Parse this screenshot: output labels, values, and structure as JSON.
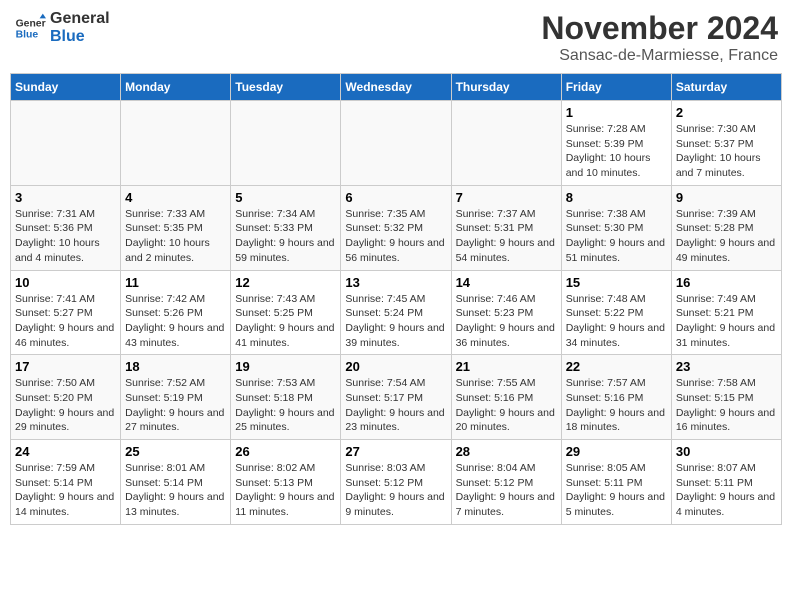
{
  "header": {
    "logo_line1": "General",
    "logo_line2": "Blue",
    "month_title": "November 2024",
    "location": "Sansac-de-Marmiesse, France"
  },
  "columns": [
    "Sunday",
    "Monday",
    "Tuesday",
    "Wednesday",
    "Thursday",
    "Friday",
    "Saturday"
  ],
  "weeks": [
    [
      {
        "day": "",
        "info": ""
      },
      {
        "day": "",
        "info": ""
      },
      {
        "day": "",
        "info": ""
      },
      {
        "day": "",
        "info": ""
      },
      {
        "day": "",
        "info": ""
      },
      {
        "day": "1",
        "info": "Sunrise: 7:28 AM\nSunset: 5:39 PM\nDaylight: 10 hours and 10 minutes."
      },
      {
        "day": "2",
        "info": "Sunrise: 7:30 AM\nSunset: 5:37 PM\nDaylight: 10 hours and 7 minutes."
      }
    ],
    [
      {
        "day": "3",
        "info": "Sunrise: 7:31 AM\nSunset: 5:36 PM\nDaylight: 10 hours and 4 minutes."
      },
      {
        "day": "4",
        "info": "Sunrise: 7:33 AM\nSunset: 5:35 PM\nDaylight: 10 hours and 2 minutes."
      },
      {
        "day": "5",
        "info": "Sunrise: 7:34 AM\nSunset: 5:33 PM\nDaylight: 9 hours and 59 minutes."
      },
      {
        "day": "6",
        "info": "Sunrise: 7:35 AM\nSunset: 5:32 PM\nDaylight: 9 hours and 56 minutes."
      },
      {
        "day": "7",
        "info": "Sunrise: 7:37 AM\nSunset: 5:31 PM\nDaylight: 9 hours and 54 minutes."
      },
      {
        "day": "8",
        "info": "Sunrise: 7:38 AM\nSunset: 5:30 PM\nDaylight: 9 hours and 51 minutes."
      },
      {
        "day": "9",
        "info": "Sunrise: 7:39 AM\nSunset: 5:28 PM\nDaylight: 9 hours and 49 minutes."
      }
    ],
    [
      {
        "day": "10",
        "info": "Sunrise: 7:41 AM\nSunset: 5:27 PM\nDaylight: 9 hours and 46 minutes."
      },
      {
        "day": "11",
        "info": "Sunrise: 7:42 AM\nSunset: 5:26 PM\nDaylight: 9 hours and 43 minutes."
      },
      {
        "day": "12",
        "info": "Sunrise: 7:43 AM\nSunset: 5:25 PM\nDaylight: 9 hours and 41 minutes."
      },
      {
        "day": "13",
        "info": "Sunrise: 7:45 AM\nSunset: 5:24 PM\nDaylight: 9 hours and 39 minutes."
      },
      {
        "day": "14",
        "info": "Sunrise: 7:46 AM\nSunset: 5:23 PM\nDaylight: 9 hours and 36 minutes."
      },
      {
        "day": "15",
        "info": "Sunrise: 7:48 AM\nSunset: 5:22 PM\nDaylight: 9 hours and 34 minutes."
      },
      {
        "day": "16",
        "info": "Sunrise: 7:49 AM\nSunset: 5:21 PM\nDaylight: 9 hours and 31 minutes."
      }
    ],
    [
      {
        "day": "17",
        "info": "Sunrise: 7:50 AM\nSunset: 5:20 PM\nDaylight: 9 hours and 29 minutes."
      },
      {
        "day": "18",
        "info": "Sunrise: 7:52 AM\nSunset: 5:19 PM\nDaylight: 9 hours and 27 minutes."
      },
      {
        "day": "19",
        "info": "Sunrise: 7:53 AM\nSunset: 5:18 PM\nDaylight: 9 hours and 25 minutes."
      },
      {
        "day": "20",
        "info": "Sunrise: 7:54 AM\nSunset: 5:17 PM\nDaylight: 9 hours and 23 minutes."
      },
      {
        "day": "21",
        "info": "Sunrise: 7:55 AM\nSunset: 5:16 PM\nDaylight: 9 hours and 20 minutes."
      },
      {
        "day": "22",
        "info": "Sunrise: 7:57 AM\nSunset: 5:16 PM\nDaylight: 9 hours and 18 minutes."
      },
      {
        "day": "23",
        "info": "Sunrise: 7:58 AM\nSunset: 5:15 PM\nDaylight: 9 hours and 16 minutes."
      }
    ],
    [
      {
        "day": "24",
        "info": "Sunrise: 7:59 AM\nSunset: 5:14 PM\nDaylight: 9 hours and 14 minutes."
      },
      {
        "day": "25",
        "info": "Sunrise: 8:01 AM\nSunset: 5:14 PM\nDaylight: 9 hours and 13 minutes."
      },
      {
        "day": "26",
        "info": "Sunrise: 8:02 AM\nSunset: 5:13 PM\nDaylight: 9 hours and 11 minutes."
      },
      {
        "day": "27",
        "info": "Sunrise: 8:03 AM\nSunset: 5:12 PM\nDaylight: 9 hours and 9 minutes."
      },
      {
        "day": "28",
        "info": "Sunrise: 8:04 AM\nSunset: 5:12 PM\nDaylight: 9 hours and 7 minutes."
      },
      {
        "day": "29",
        "info": "Sunrise: 8:05 AM\nSunset: 5:11 PM\nDaylight: 9 hours and 5 minutes."
      },
      {
        "day": "30",
        "info": "Sunrise: 8:07 AM\nSunset: 5:11 PM\nDaylight: 9 hours and 4 minutes."
      }
    ]
  ]
}
